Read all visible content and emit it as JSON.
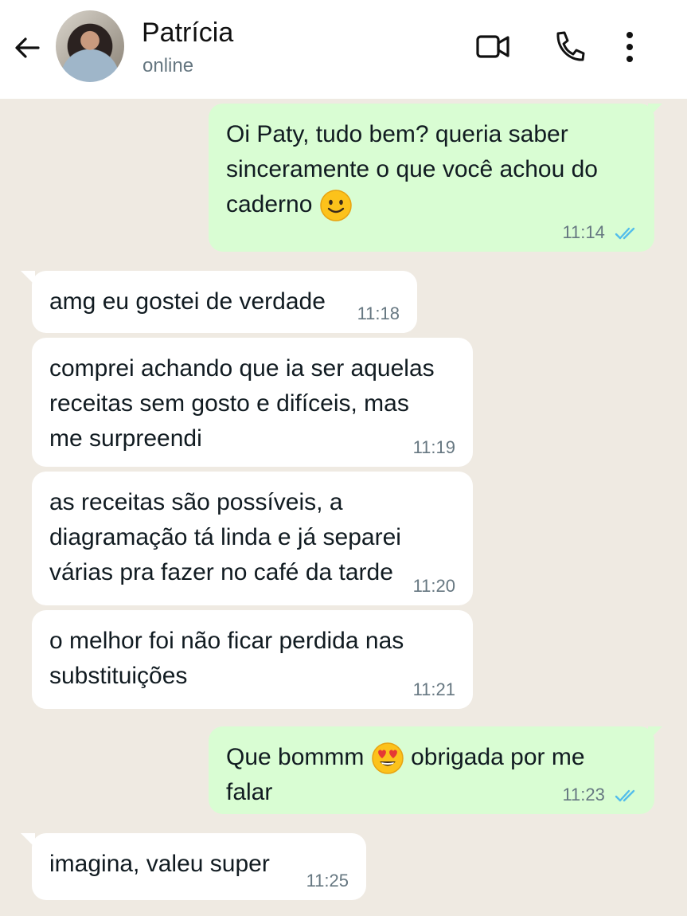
{
  "header": {
    "name": "Patrícia",
    "status": "online"
  },
  "colors": {
    "chat_bg": "#efeae2",
    "outgoing_bubble": "#d9fdd3",
    "incoming_bubble": "#ffffff",
    "read_ticks": "#53bdeb"
  },
  "icons": [
    "back-arrow-icon",
    "video-call-icon",
    "phone-icon",
    "more-vert-icon",
    "double-check-icon",
    "smile-emoji",
    "heart-eyes-emoji"
  ],
  "messages": [
    {
      "direction": "out",
      "lines": [
        "Oi Paty, tudo bem? queria saber",
        "sinceramente o que você achou do",
        "caderno"
      ],
      "emoji": "smile-emoji",
      "time": "11:14",
      "read": true
    },
    {
      "direction": "in",
      "lines": [
        "amg eu gostei de verdade"
      ],
      "time": "11:18"
    },
    {
      "direction": "in",
      "lines": [
        "comprei achando que ia ser aquelas",
        "receitas sem gosto e difíceis, mas",
        "me surpreendi"
      ],
      "time": "11:19"
    },
    {
      "direction": "in",
      "lines": [
        "as receitas são possíveis, a",
        "diagramação tá linda e já separei",
        "várias pra fazer no café da tarde"
      ],
      "time": "11:20"
    },
    {
      "direction": "in",
      "lines": [
        "o melhor foi não ficar perdida nas",
        "substituições"
      ],
      "time": "11:21"
    },
    {
      "direction": "out",
      "text_before": "Que bommm",
      "emoji": "heart-eyes-emoji",
      "text_after": "obrigada por me falar",
      "time": "11:23",
      "read": true
    },
    {
      "direction": "in",
      "lines": [
        "imagina, valeu super"
      ],
      "time": "11:25"
    }
  ]
}
